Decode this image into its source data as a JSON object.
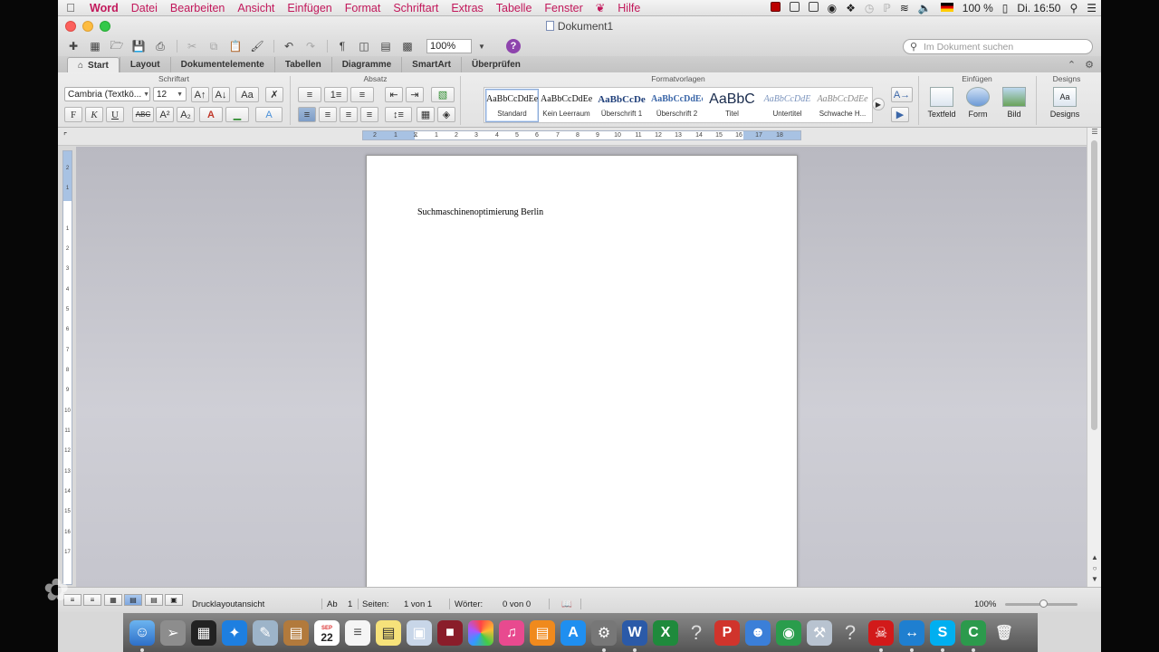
{
  "menubar": {
    "items": [
      "Word",
      "Datei",
      "Bearbeiten",
      "Ansicht",
      "Einfügen",
      "Format",
      "Schriftart",
      "Extras",
      "Tabelle",
      "Fenster",
      "Hilfe"
    ],
    "battery": "100 %",
    "clock": "Di. 16:50"
  },
  "window": {
    "title": "Dokument1"
  },
  "toolbar": {
    "zoom": "100%",
    "search_placeholder": "Im Dokument suchen"
  },
  "tabs": [
    "Start",
    "Layout",
    "Dokumentelemente",
    "Tabellen",
    "Diagramme",
    "SmartArt",
    "Überprüfen"
  ],
  "ribbon": {
    "group_labels": {
      "font": "Schriftart",
      "paragraph": "Absatz",
      "styles": "Formatvorlagen",
      "insert": "Einfügen",
      "designs": "Designs"
    },
    "font_name": "Cambria (Textkö...",
    "font_size": "12",
    "format_buttons": {
      "bold": "F",
      "italic": "K",
      "underline": "U",
      "strike": "ABC"
    },
    "styles": [
      {
        "preview": "AaBbCcDdEe",
        "name": "Standard"
      },
      {
        "preview": "AaBbCcDdEe",
        "name": "Kein Leerraum"
      },
      {
        "preview": "AaBbCcDe",
        "name": "Überschrift 1"
      },
      {
        "preview": "AaBbCcDdEe",
        "name": "Überschrift 2"
      },
      {
        "preview": "AaBbC",
        "name": "Titel"
      },
      {
        "preview": "AaBbCcDdE",
        "name": "Untertitel"
      },
      {
        "preview": "AaBbCcDdEe",
        "name": "Schwache H..."
      }
    ],
    "insert_buttons": [
      "Textfeld",
      "Form",
      "Bild"
    ],
    "designs_button": "Designs",
    "designs_icon_text": "Aa"
  },
  "ruler": {
    "numbers": [
      "2",
      "1",
      "1",
      "2",
      "3",
      "4",
      "5",
      "6",
      "7",
      "8",
      "9",
      "10",
      "11",
      "12",
      "13",
      "14",
      "15",
      "16",
      "17",
      "18"
    ]
  },
  "vruler": {
    "numbers": [
      "2",
      "1",
      "1",
      "2",
      "3",
      "4",
      "5",
      "6",
      "7",
      "8",
      "9",
      "10",
      "11",
      "12",
      "13",
      "14",
      "15",
      "16",
      "17"
    ]
  },
  "document": {
    "text": "Suchmaschinenoptimierung Berlin"
  },
  "status": {
    "view": "Drucklayoutansicht",
    "ab_label": "Ab",
    "ab_value": "1",
    "pages_label": "Seiten:",
    "pages_value": "1 von 1",
    "words_label": "Wörter:",
    "words_value": "0 von 0",
    "zoom": "100%"
  },
  "dock": {
    "calendar_month": "SEP",
    "calendar_day": "22"
  }
}
